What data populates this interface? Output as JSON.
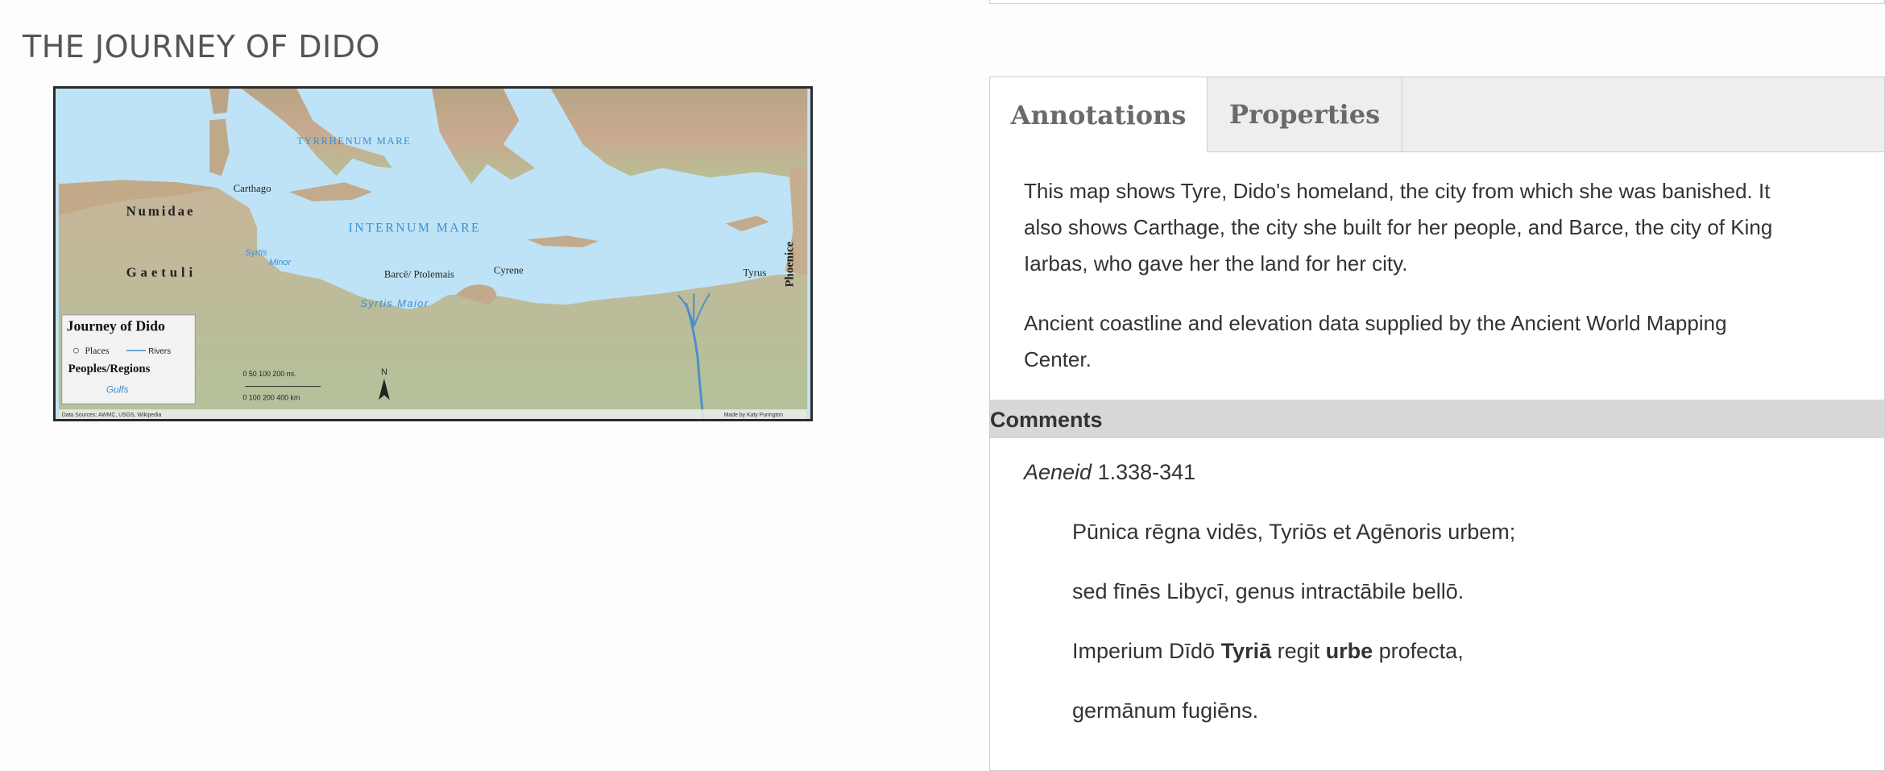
{
  "page": {
    "title": "THE JOURNEY OF DIDO"
  },
  "map": {
    "labels": {
      "sea_main": "INTERNUM MARE",
      "sea_north": "TYRRHENUM MARE",
      "carthago": "Carthago",
      "numidae": "Numidae",
      "gaetuli": "Gaetuli",
      "syrtis_minor_1": "Syrtis",
      "syrtis_minor_2": "Minor",
      "syrtis_maior": "Syrtis Maior",
      "barce": "Barcē/ Ptolemais",
      "cyrene": "Cyrene",
      "tyrus": "Tyrus",
      "phoenice": "Phoenice"
    },
    "legend": {
      "title": "Journey of Dido",
      "places": "Places",
      "rivers": "Rivers",
      "peoples": "Peoples/Regions",
      "gulfs": "Gulfs"
    },
    "scale": {
      "top": "0   50  100      200 mi.",
      "bottom": "0    100  200         400 km"
    },
    "north": "N",
    "credits_left": "Data Sources: AWMC, USGS, Wikipedia",
    "credits_right": "Made by Katy Purington",
    "colors": {
      "sea": "#bfe3f6",
      "land": "#c9b79a",
      "lowland": "#b9c79a",
      "river": "#4a90c9"
    }
  },
  "tabs": {
    "annotations": "Annotations",
    "properties": "Properties"
  },
  "annotation": {
    "p1_line1": "This map shows Tyre, Dido's homeland, the city from which she was banished.  It",
    "p1_line2": "also shows Carthage, the city she built for her people, and Barce, the city of King",
    "p1_line3": "Iarbas, who gave her the land for her city.",
    "p2_line1": "Ancient coastline and elevation data supplied by the Ancient World Mapping",
    "p2_line2": "Center."
  },
  "comments": {
    "label": "Comments",
    "cite_title": "Aeneid",
    "cite_ref": " 1.338-341",
    "verse1": "Pūnica rēgna vidēs, Tyriōs et Agēnoris urbem;",
    "verse2": "sed fīnēs Libycī, genus intractābile bellō.",
    "verse3_a": "Imperium Dīdō ",
    "verse3_b": "Tyriā",
    "verse3_c": " regit ",
    "verse3_d": "urbe",
    "verse3_e": " profecta,",
    "verse4": "germānum fugiēns."
  }
}
